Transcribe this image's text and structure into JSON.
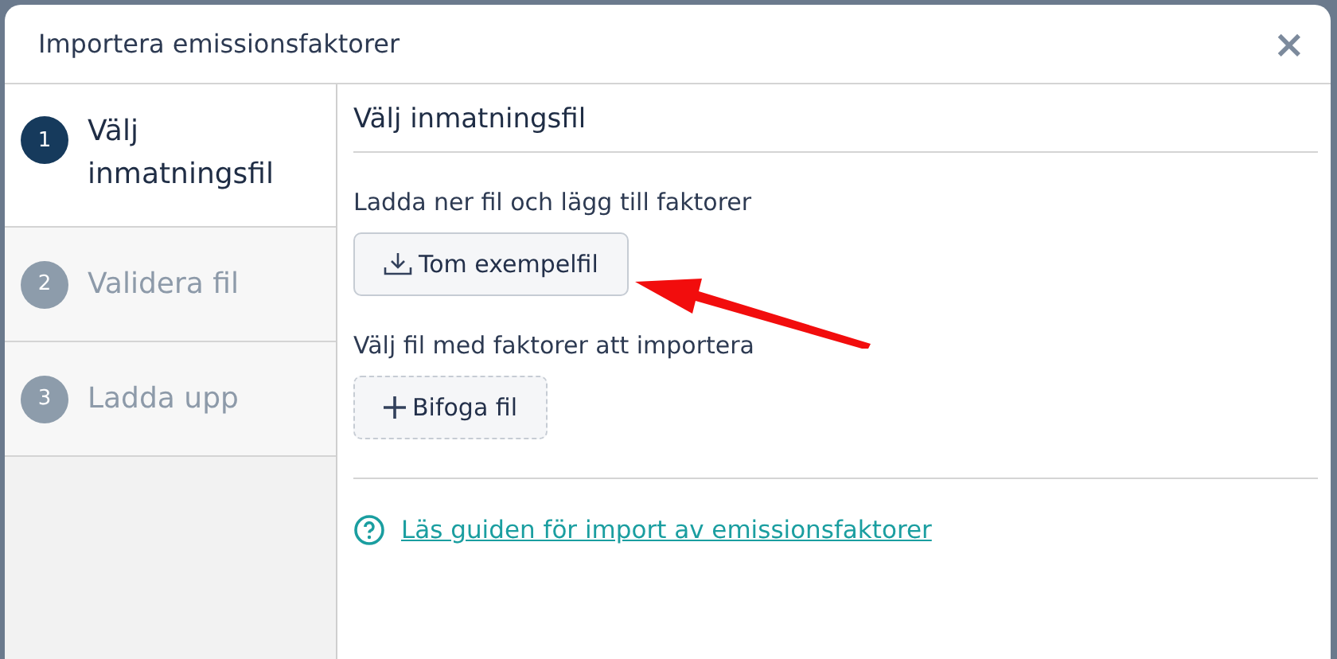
{
  "dialog": {
    "title": "Importera emissionsfaktorer",
    "close": "×"
  },
  "steps": [
    {
      "number": "1",
      "label": "Välj inmatningsfil",
      "selected": true
    },
    {
      "number": "2",
      "label": "Validera fil",
      "selected": false
    },
    {
      "number": "3",
      "label": "Ladda upp",
      "selected": false
    }
  ],
  "content": {
    "heading": "Välj inmatningsfil",
    "sections": [
      {
        "label": "Ladda ner fil och lägg till faktorer",
        "button": "Tom exempelfil",
        "kind": "download"
      },
      {
        "label": "Välj fil med faktorer att importera",
        "button": "Bifoga fil",
        "kind": "attach"
      }
    ],
    "help_link": "Läs guiden för import av emissionsfaktorer"
  }
}
